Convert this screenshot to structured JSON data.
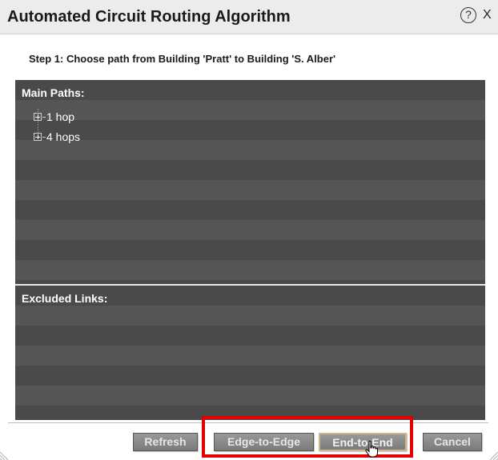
{
  "window": {
    "title": "Automated Circuit Routing Algorithm",
    "help_glyph": "?",
    "close_glyph": "X"
  },
  "step_text": "Step 1: Choose path from Building 'Pratt' to Building 'S. Alber'",
  "main_paths": {
    "label": "Main Paths:",
    "items": [
      {
        "label": "1 hop",
        "icon": "plus-icon"
      },
      {
        "label": "4 hops",
        "icon": "plus-icon"
      }
    ]
  },
  "excluded_links": {
    "label": "Excluded Links:"
  },
  "buttons": {
    "refresh": "Refresh",
    "edge_to_edge": "Edge-to-Edge",
    "end_to_end": "End-to-End",
    "cancel": "Cancel"
  },
  "colors": {
    "panel_dark": "#4a4a4a",
    "panel_light": "#555555",
    "highlight": "#e00000",
    "button": "#8a8a8a"
  }
}
